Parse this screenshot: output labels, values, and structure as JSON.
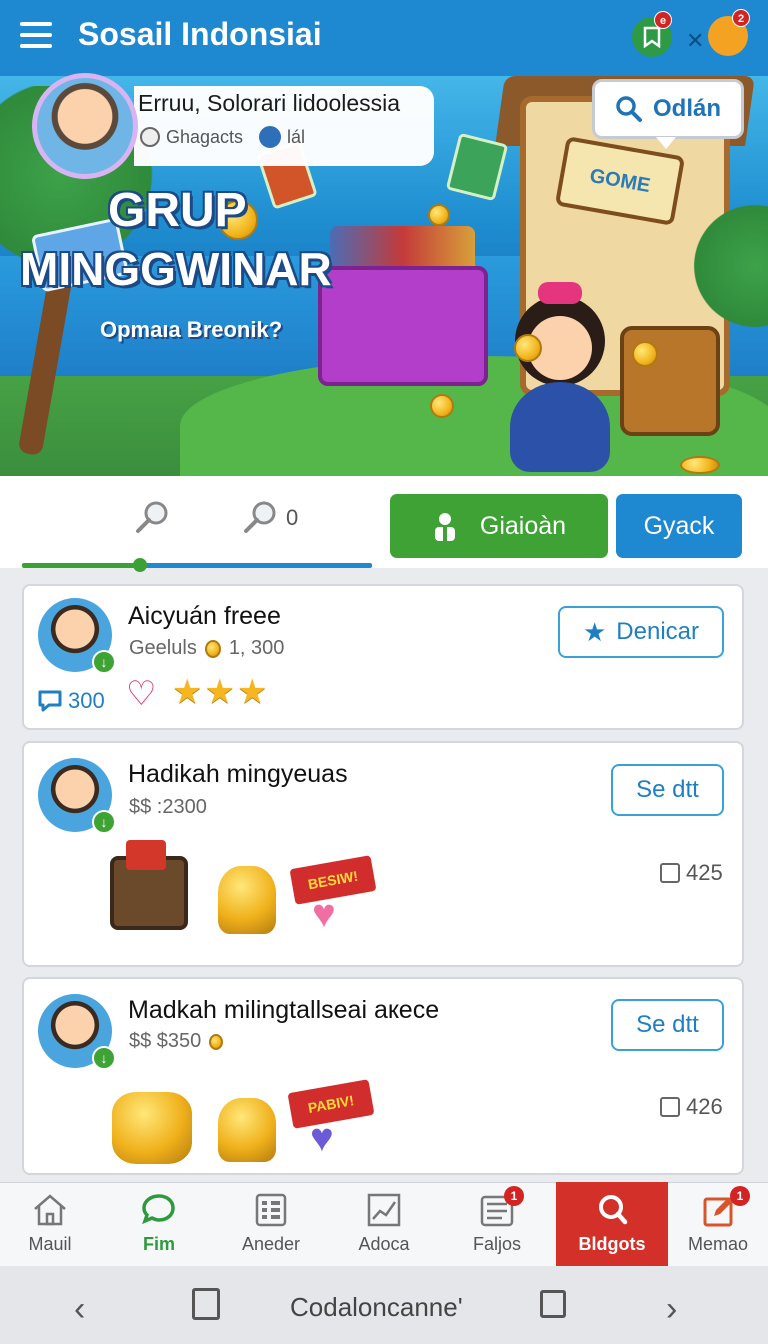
{
  "app": {
    "title": "Sosail Indonsiai",
    "save_badge": "e",
    "pet_badge": "2"
  },
  "profile": {
    "name": "Erruu, Solorari lidoolessia",
    "meta": "Ghagacts",
    "meta2": "lál"
  },
  "search_button": {
    "label": "Odlán"
  },
  "banner": {
    "title_line1": "GRUP",
    "title_line2": "MINGGWINAR",
    "subtitle": "Opmaıa Breonik?",
    "sign": "GOME"
  },
  "tabs": {
    "count_b": "0",
    "btn_green": "Giaioàn",
    "btn_blue": "Gyack"
  },
  "cards": [
    {
      "title": "Aicyuán freee",
      "sub_label": "Geeluls",
      "sub_value": "1, 300",
      "button": "Denicar",
      "comments": "300",
      "stars": "★★★"
    },
    {
      "title": "Hadikah mingyeuas",
      "sub": "$$ :2300",
      "button": "Se dtt",
      "count": "425",
      "sticker_banner": "BESIW!"
    },
    {
      "title": "Madkah milingtallseai aкece",
      "sub": "$$ $350",
      "button": "Se dtt",
      "count": "426",
      "sticker_banner": "PABIV!"
    }
  ],
  "bottom_nav": [
    {
      "label": "Mauil",
      "icon": "home-icon"
    },
    {
      "label": "Fim",
      "icon": "chat-icon"
    },
    {
      "label": "Aneder",
      "icon": "grid-list-icon"
    },
    {
      "label": "Adoca",
      "icon": "chart-icon"
    },
    {
      "label": "Faljos",
      "icon": "list-icon",
      "badge": "1"
    },
    {
      "label": "Bldgots",
      "icon": "search-icon"
    },
    {
      "label": "Memao",
      "icon": "edit-icon",
      "badge": "1"
    }
  ],
  "system_nav": {
    "label": "Codaloncanne'"
  },
  "colors": {
    "primary": "#1e88d0",
    "green": "#3ea334",
    "active_red": "#d4302a"
  }
}
